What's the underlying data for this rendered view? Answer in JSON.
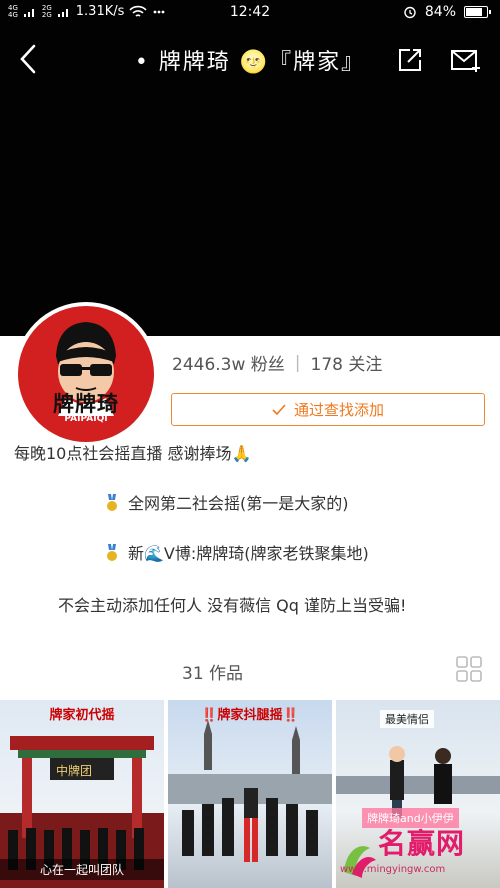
{
  "status_bar": {
    "signal_left_a": "4G",
    "signal_left_b": "2G",
    "network_speed": "1.31K/s",
    "time": "12:42",
    "battery": "84%",
    "battery_level": 0.84
  },
  "header": {
    "title": "• 牌牌琦 🌝『牌家』"
  },
  "profile": {
    "avatar_name": "牌牌琦",
    "avatar_pinyin": "PAIPAIQI",
    "followers": "2446.3w 粉丝",
    "following": "178 关注",
    "follow_button": "通过查找添加",
    "bio_line1": "每晚10点社会摇直播 感谢捧场🙏",
    "bio_line2": "全网第二社会摇(第一是大家的)",
    "bio_line3": "新🌊V博:牌牌琦(牌家老铁聚集地)",
    "bio_line4": "不会主动添加任何人 没有薇信 Qq 谨防上当受骗!"
  },
  "works": {
    "count_label": "31 作品"
  },
  "thumbnails": [
    {
      "title": "牌家初代摇",
      "caption": "心在一起叫团队",
      "sign": "中牌团"
    },
    {
      "title": "‼️牌家抖腿摇‼️"
    },
    {
      "tag": "最美情侣",
      "subtitle": "牌牌琦and小伊伊"
    }
  ],
  "watermark": {
    "text": "名赢网",
    "url": "www.mingyingw.com"
  },
  "colors": {
    "accent": "#ee7a20",
    "avatar_red": "#d21f1f",
    "header_bg": "#020202"
  }
}
